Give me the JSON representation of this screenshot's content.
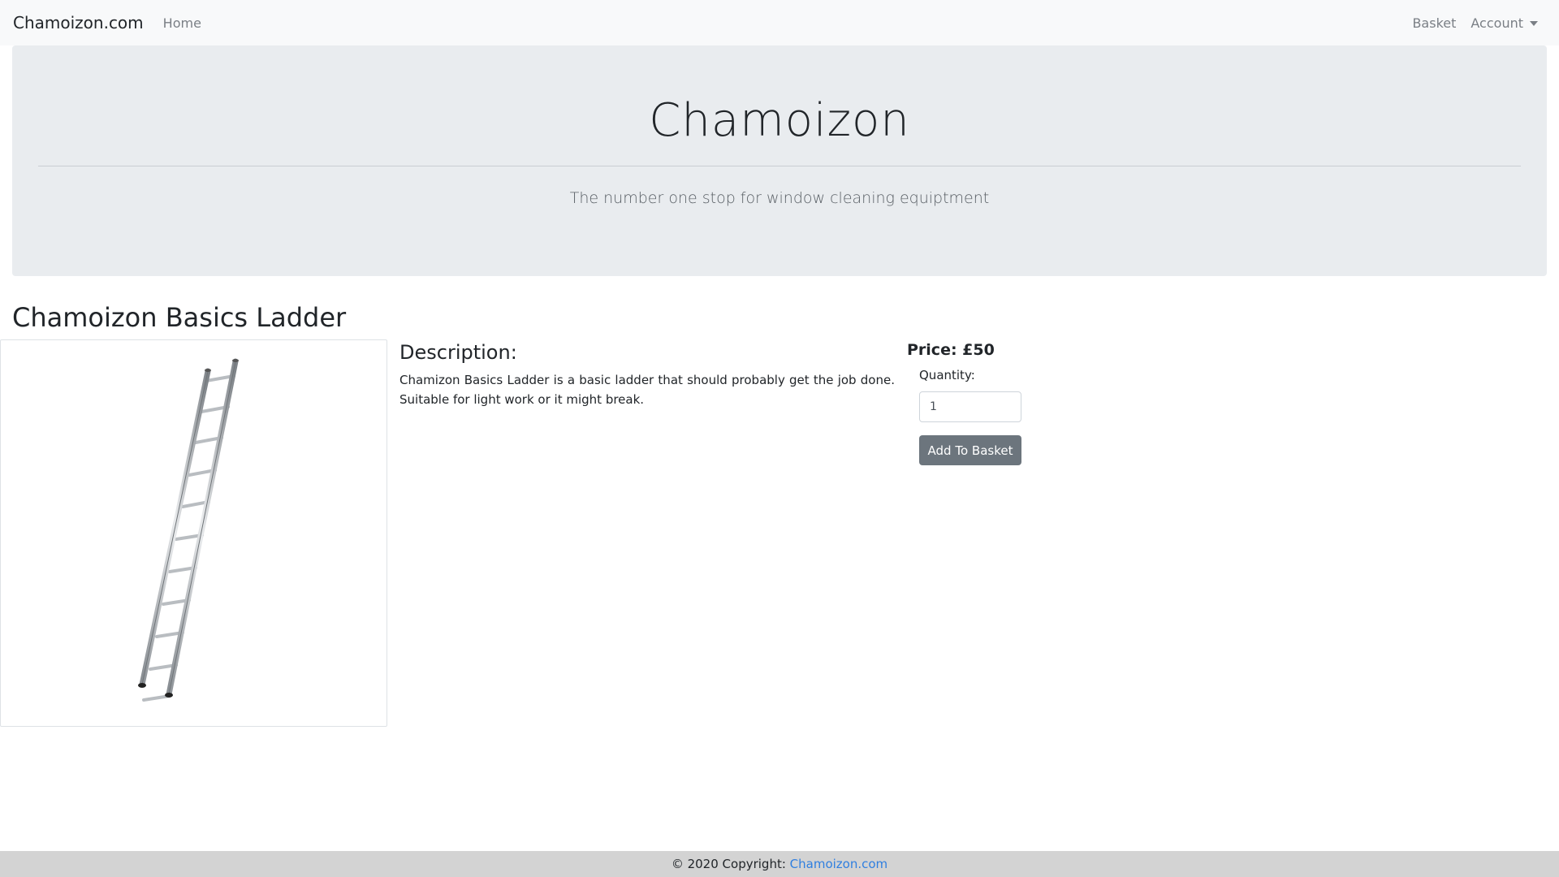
{
  "navbar": {
    "brand": "Chamoizon.com",
    "home": "Home",
    "basket": "Basket",
    "account": "Account"
  },
  "jumbotron": {
    "title": "Chamoizon",
    "tagline": "The number one stop for window cleaning equiptment"
  },
  "product": {
    "title": "Chamoizon Basics Ladder",
    "image_alt": "ladder",
    "description_heading": "Description:",
    "description": "Chamizon Basics Ladder is a basic ladder that should probably get the job done. Suitable for light work or it might break.",
    "price": "Price: £50",
    "quantity_label": "Quantity:",
    "quantity_value": "1",
    "add_button": "Add To Basket"
  },
  "footer": {
    "copyright": "© 2020 Copyright:",
    "link": "Chamoizon.com"
  },
  "colors": {
    "navbar_bg": "#f8f9fa",
    "jumbotron_bg": "#e9ecef",
    "button_bg": "#6c757d",
    "footer_bg": "#d3d3d3",
    "link": "#2f7fe0"
  }
}
